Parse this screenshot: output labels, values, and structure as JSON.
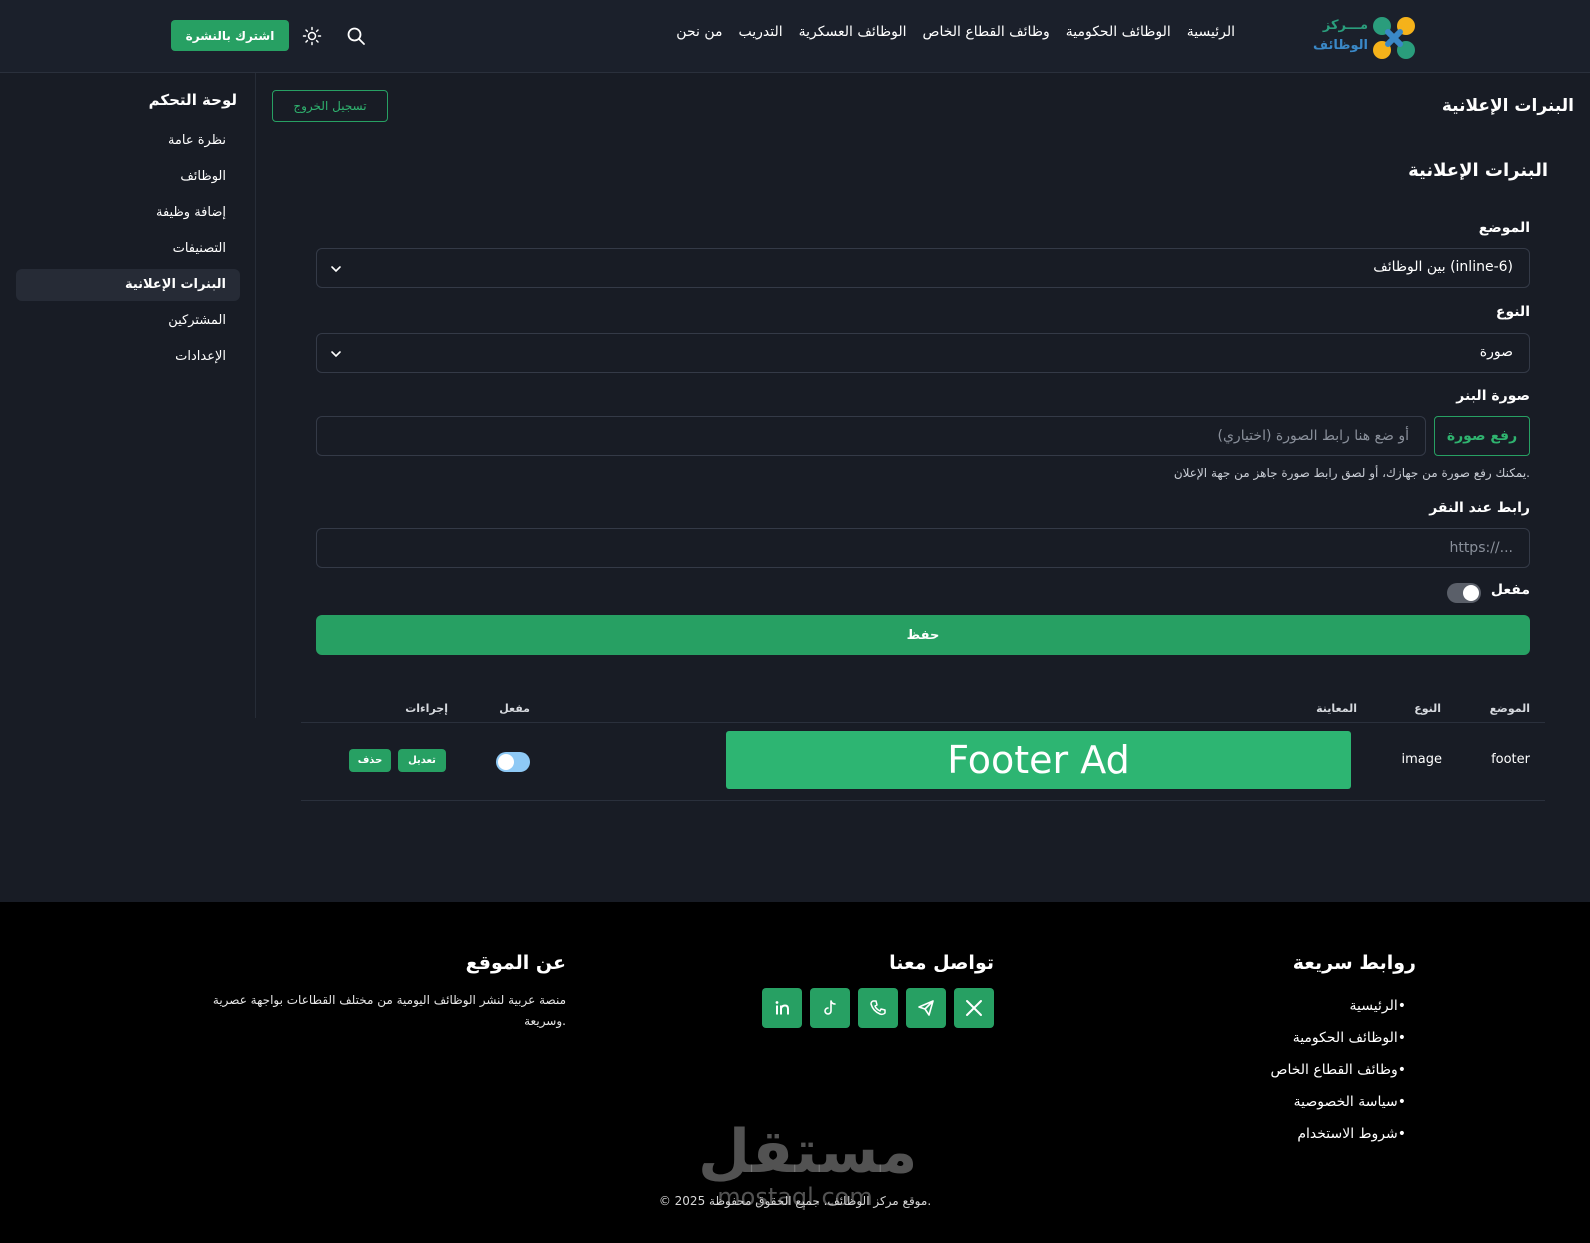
{
  "header": {
    "logo_line1": "مـــركز",
    "logo_line2": "الوظائف",
    "nav": [
      "الرئيسية",
      "الوظائف الحكومية",
      "وظائف القطاع الخاص",
      "الوظائف العسكرية",
      "التدريب",
      "من نحن"
    ],
    "subscribe_label": "اشترك بالنشرة"
  },
  "sidebar": {
    "title": "لوحة التحكم",
    "items": [
      {
        "label": "نظرة عامة",
        "active": false
      },
      {
        "label": "الوظائف",
        "active": false
      },
      {
        "label": "إضافة وظيفة",
        "active": false
      },
      {
        "label": "التصنيفات",
        "active": false
      },
      {
        "label": "البنرات الإعلانية",
        "active": true
      },
      {
        "label": "المشتركين",
        "active": false
      },
      {
        "label": "الإعدادات",
        "active": false
      }
    ]
  },
  "main": {
    "page_title": "البنرات الإعلانية",
    "logout_label": "تسجيل الخروج",
    "section_title": "البنرات الإعلانية",
    "form": {
      "position_label": "الموضع",
      "position_value": "بين الوظائف (inline-6)",
      "type_label": "النوع",
      "type_value": "صورة",
      "image_label": "صورة البنر",
      "upload_label": "رفع صورة",
      "image_url_placeholder": "أو ضع هنا رابط الصورة (اختياري)",
      "image_help": "يمكنك رفع صورة من جهازك، أو لصق رابط صورة جاهز من جهة الإعلان.",
      "click_url_label": "رابط عند النقر",
      "click_url_placeholder": "https://...",
      "enabled_label": "مفعل",
      "enabled": true,
      "save_label": "حفظ"
    },
    "table": {
      "headers": {
        "position": "الموضع",
        "type": "النوع",
        "preview": "المعاينة",
        "enabled": "مفعل",
        "actions": "إجراءات"
      },
      "rows": [
        {
          "position": "footer",
          "type": "image",
          "preview_text": "Footer Ad",
          "enabled": true,
          "edit_label": "تعديل",
          "delete_label": "حذف"
        }
      ]
    }
  },
  "footer": {
    "quick_links_title": "روابط سريعة",
    "quick_links": [
      "الرئيسية",
      "الوظائف الحكومية",
      "وظائف القطاع الخاص",
      "سياسة الخصوصية",
      "شروط الاستخدام"
    ],
    "contact_title": "تواصل معنا",
    "social_icons": [
      "x-icon",
      "telegram-icon",
      "phone-icon",
      "tiktok-icon",
      "linkedin-icon"
    ],
    "about_title": "عن الموقع",
    "about_text": "منصة عربية لنشر الوظائف اليومية من مختلف القطاعات بواجهة عصرية وسريعة.",
    "copyright": "© 2025 موقع مركز الوظائف. جميع الحقوق محفوظة."
  },
  "watermark": {
    "arabic": "مستقل",
    "latin": "mostaql.com"
  },
  "colors": {
    "accent": "#27a063",
    "background": "#181c25",
    "header": "#1b202b",
    "footer": "#000000",
    "toggle_on": "#8ec9f5"
  }
}
